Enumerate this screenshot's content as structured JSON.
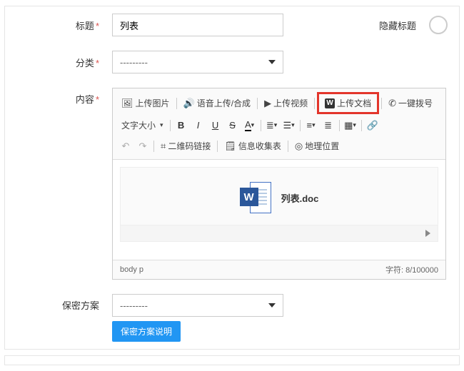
{
  "form": {
    "title": {
      "label": "标题",
      "value": "列表",
      "hide_label": "隐藏标题"
    },
    "category": {
      "label": "分类",
      "value": "---------"
    },
    "content": {
      "label": "内容"
    },
    "scheme": {
      "label": "保密方案",
      "value": "---------",
      "desc_btn": "保密方案说明"
    }
  },
  "toolbar": {
    "upload_image": "上传图片",
    "voice_upload": "语音上传/合成",
    "upload_video": "上传视频",
    "upload_doc": "上传文档",
    "dial": "一键拨号",
    "font_size": "文字大小",
    "qr_link": "二维码链接",
    "info_form": "信息收集表",
    "geo": "地理位置"
  },
  "editor": {
    "attachment_name": "列表.doc",
    "path": "body   p",
    "char_label": "字符:",
    "char_count": "8/100000"
  }
}
